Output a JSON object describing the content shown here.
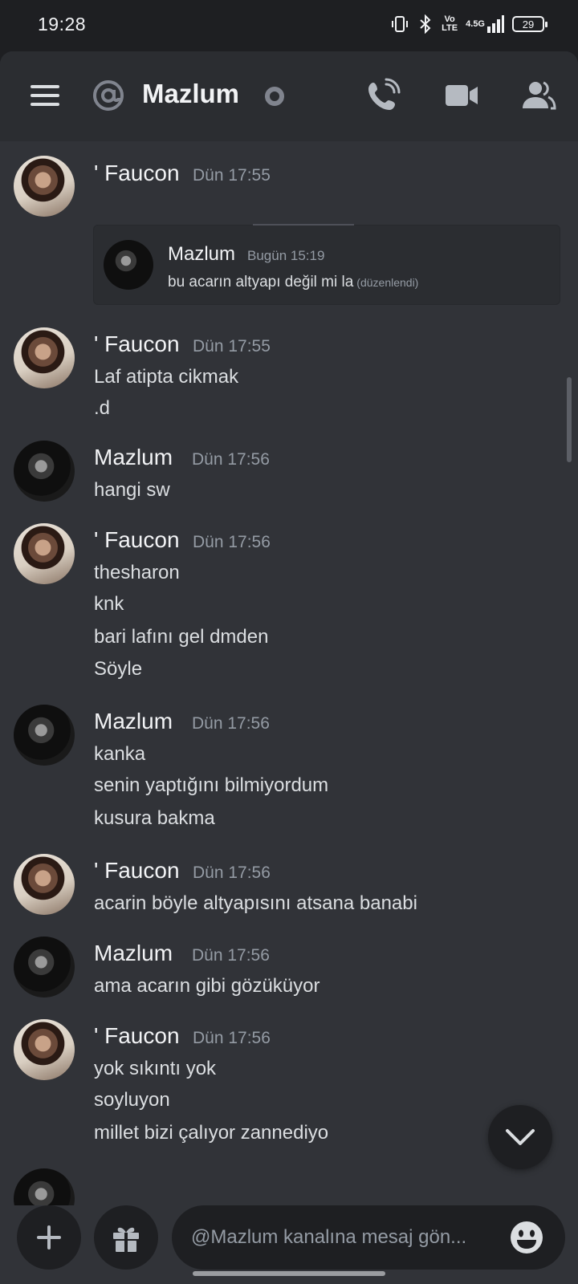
{
  "status_bar": {
    "time": "19:28",
    "network": "4.5G",
    "volte": "Vo LTE",
    "battery": "29"
  },
  "header": {
    "channel_name": "Mazlum",
    "menu_icon": "hamburger-icon",
    "call_icon": "phone-call-icon",
    "video_icon": "video-camera-icon",
    "members_icon": "members-icon"
  },
  "messages": [
    {
      "author": "' Faucon",
      "timestamp": "Dün 17:55",
      "lines": [],
      "reply": {
        "author": "Mazlum",
        "timestamp": "Bugün 15:19",
        "text": "bu acarın altyapı değil mi la",
        "edited": "(düzenlendi)"
      }
    },
    {
      "author": "' Faucon",
      "timestamp": "Dün 17:55",
      "lines": [
        "Laf atipta cikmak",
        ".d"
      ]
    },
    {
      "author": "Mazlum",
      "timestamp": "Dün 17:56",
      "lines": [
        "hangi sw"
      ]
    },
    {
      "author": "' Faucon",
      "timestamp": "Dün 17:56",
      "lines": [
        "thesharon",
        "knk",
        "bari lafını gel dmden",
        "Söyle"
      ]
    },
    {
      "author": "Mazlum",
      "timestamp": "Dün 17:56",
      "lines": [
        "kanka",
        "senin yaptığını bilmiyordum",
        "kusura bakma"
      ]
    },
    {
      "author": "' Faucon",
      "timestamp": "Dün 17:56",
      "lines": [
        "acarin böyle altyapısını atsana banabi"
      ]
    },
    {
      "author": "Mazlum",
      "timestamp": "Dün 17:56",
      "lines": [
        "ama acarın gibi gözüküyor"
      ]
    },
    {
      "author": "' Faucon",
      "timestamp": "Dün 17:56",
      "lines": [
        "yok sıkıntı yok",
        "soyluyon",
        "millet bizi çalıyor zannediyo"
      ]
    }
  ],
  "composer": {
    "placeholder": "@Mazlum kanalına mesaj gön...",
    "add_icon": "plus-icon",
    "gift_icon": "gift-icon",
    "emoji_icon": "emoji-icon"
  },
  "colors": {
    "background": "#313338",
    "header": "#2b2d31",
    "input": "#1e1f22",
    "text": "#dbdee1",
    "muted": "#949ba4"
  }
}
